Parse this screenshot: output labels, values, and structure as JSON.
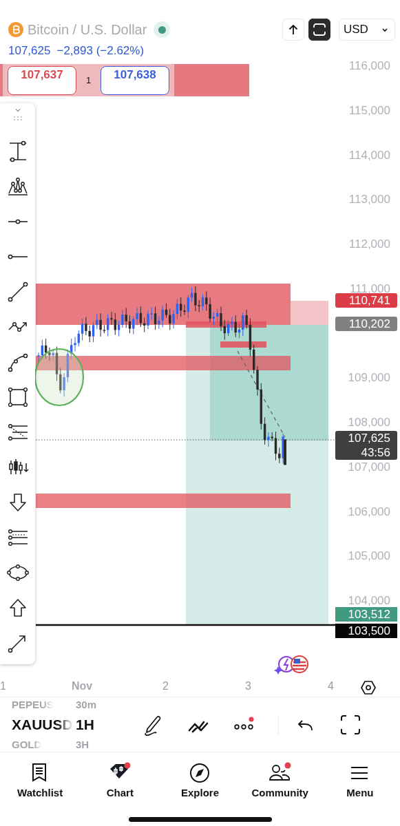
{
  "header": {
    "symbol_title": "Bitcoin / U.S. Dollar",
    "market_open": true,
    "last_price": "107,625",
    "change": "−2,893 (−2.62%)",
    "currency": "USD"
  },
  "order_bar": {
    "sell_price": "107,637",
    "quantity": "1",
    "buy_price": "107,638"
  },
  "chart": {
    "price_axis": [
      "116,000",
      "115,000",
      "114,000",
      "113,000",
      "112,000",
      "111,000",
      "109,000",
      "108,000",
      "107,000",
      "106,000",
      "105,000",
      "104,000"
    ],
    "price_tags": [
      {
        "text": "110,741",
        "kind": "alert"
      },
      {
        "text": "110,202",
        "kind": "line"
      },
      {
        "text": "107,625",
        "countdown": "43:56",
        "kind": "last"
      },
      {
        "text": "103,512",
        "kind": "target"
      },
      {
        "text": "103,500",
        "kind": "level"
      }
    ],
    "time_axis": [
      {
        "label": "1",
        "month": false
      },
      {
        "label": "Nov",
        "month": true
      },
      {
        "label": "2",
        "month": false
      },
      {
        "label": "3",
        "month": false
      },
      {
        "label": "4",
        "month": false
      }
    ]
  },
  "bottom_toolbar": {
    "symbols": [
      {
        "label": "PEPEUS",
        "selected": false
      },
      {
        "label": "XAUUSD",
        "selected": true
      },
      {
        "label": "GOLD",
        "selected": false
      }
    ],
    "intervals": [
      {
        "label": "30m",
        "selected": false
      },
      {
        "label": "1H",
        "selected": true
      },
      {
        "label": "3H",
        "selected": false
      }
    ],
    "more_badge": true
  },
  "nav": [
    {
      "label": "Watchlist",
      "badge": false
    },
    {
      "label": "Chart",
      "badge": true
    },
    {
      "label": "Explore",
      "badge": false
    },
    {
      "label": "Community",
      "badge": true
    },
    {
      "label": "Menu",
      "badge": false
    }
  ]
}
